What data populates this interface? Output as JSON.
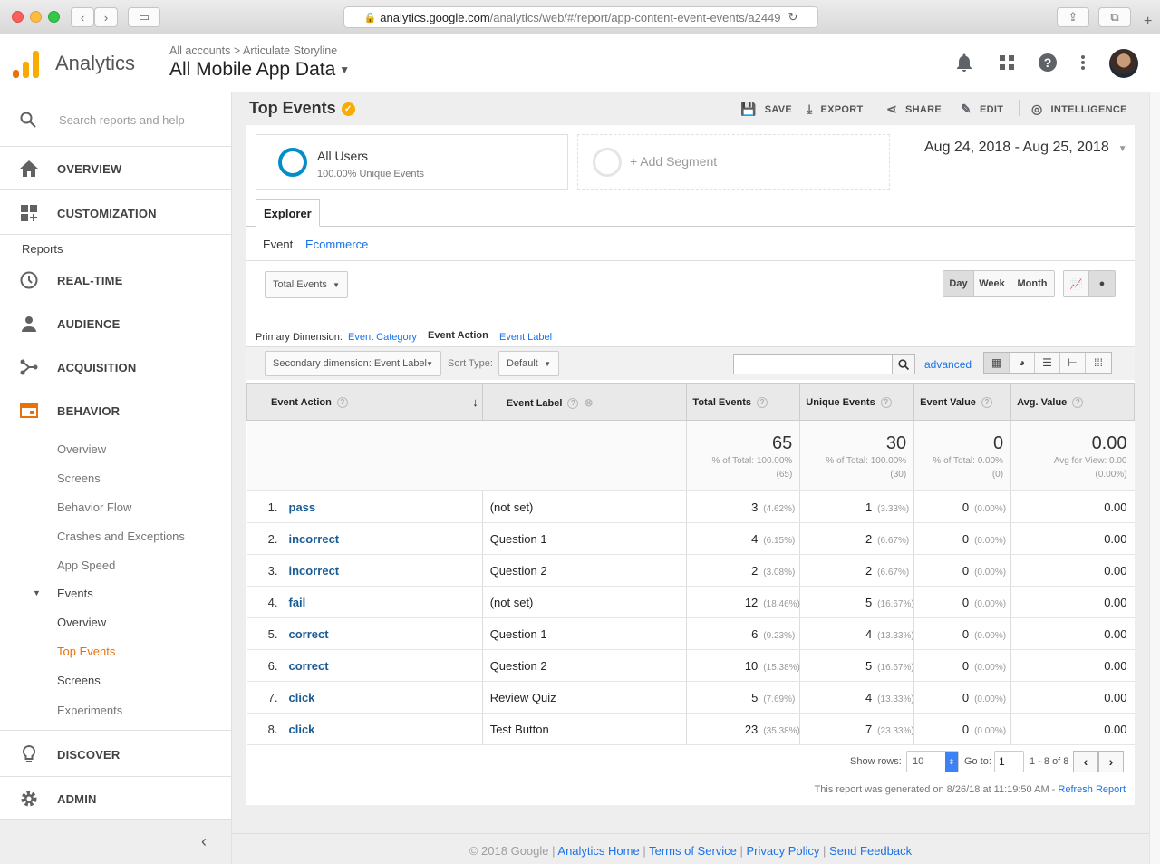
{
  "browser": {
    "url_host": "analytics.google.com",
    "url_path": "/analytics/web/#/report/app-content-event-events/a2449"
  },
  "header": {
    "brand": "Analytics",
    "crumb_root": "All accounts",
    "crumb_sep": ">",
    "crumb_account": "Articulate Storyline",
    "view_name": "All Mobile App Data",
    "icons": [
      "bell-icon",
      "apps-grid-icon",
      "help-icon",
      "more-vert-icon",
      "avatar"
    ]
  },
  "sidebar": {
    "search_placeholder": "Search reports and help",
    "overview": "OVERVIEW",
    "customization": "CUSTOMIZATION",
    "reports_heading": "Reports",
    "realtime": "REAL-TIME",
    "audience": "AUDIENCE",
    "acquisition": "ACQUISITION",
    "behavior": "BEHAVIOR",
    "behavior_sub": [
      "Overview",
      "Screens",
      "Behavior Flow",
      "Crashes and Exceptions",
      "App Speed"
    ],
    "events_label": "Events",
    "events_sub": [
      "Overview",
      "Top Events",
      "Screens"
    ],
    "experiments": "Experiments",
    "discover": "DISCOVER",
    "admin": "ADMIN",
    "accent": "#e8710a"
  },
  "report": {
    "title": "Top Events",
    "actions": {
      "save": "SAVE",
      "export": "EXPORT",
      "share": "SHARE",
      "edit": "EDIT",
      "intelligence": "INTELLIGENCE"
    },
    "segment": {
      "name": "All Users",
      "desc": "100.00% Unique Events",
      "add": "+ Add Segment"
    },
    "date_range": "Aug 24, 2018 - Aug 25, 2018",
    "tab": "Explorer",
    "subtabs": {
      "event": "Event",
      "ecommerce": "Ecommerce"
    },
    "metric_select": "Total Events",
    "granularity": {
      "day": "Day",
      "week": "Week",
      "month": "Month"
    },
    "primary_dim_label": "Primary Dimension:",
    "primary_dims": {
      "category": "Event Category",
      "action": "Event Action",
      "label": "Event Label"
    },
    "secondary_dim": "Secondary dimension: Event Label",
    "sort_type_label": "Sort Type:",
    "sort_type": "Default",
    "advanced": "advanced",
    "columns": [
      "Event Action",
      "Event Label",
      "Total Events",
      "Unique Events",
      "Event Value",
      "Avg. Value"
    ],
    "totals": {
      "total_events": "65",
      "total_events_sub1": "% of Total: 100.00%",
      "total_events_sub2": "(65)",
      "unique_events": "30",
      "unique_events_sub1": "% of Total: 100.00%",
      "unique_events_sub2": "(30)",
      "event_value": "0",
      "event_value_sub1": "% of Total: 0.00%",
      "event_value_sub2": "(0)",
      "avg_value": "0.00",
      "avg_value_sub1": "Avg for View: 0.00",
      "avg_value_sub2": "(0.00%)"
    },
    "rows": [
      {
        "n": "1.",
        "action": "pass",
        "label": "(not set)",
        "total": "3",
        "total_pct": "(4.62%)",
        "unique": "1",
        "unique_pct": "(3.33%)",
        "value": "0",
        "value_pct": "(0.00%)",
        "avg": "0.00"
      },
      {
        "n": "2.",
        "action": "incorrect",
        "label": "Question 1",
        "total": "4",
        "total_pct": "(6.15%)",
        "unique": "2",
        "unique_pct": "(6.67%)",
        "value": "0",
        "value_pct": "(0.00%)",
        "avg": "0.00"
      },
      {
        "n": "3.",
        "action": "incorrect",
        "label": "Question 2",
        "total": "2",
        "total_pct": "(3.08%)",
        "unique": "2",
        "unique_pct": "(6.67%)",
        "value": "0",
        "value_pct": "(0.00%)",
        "avg": "0.00"
      },
      {
        "n": "4.",
        "action": "fail",
        "label": "(not set)",
        "total": "12",
        "total_pct": "(18.46%)",
        "unique": "5",
        "unique_pct": "(16.67%)",
        "value": "0",
        "value_pct": "(0.00%)",
        "avg": "0.00"
      },
      {
        "n": "5.",
        "action": "correct",
        "label": "Question 1",
        "total": "6",
        "total_pct": "(9.23%)",
        "unique": "4",
        "unique_pct": "(13.33%)",
        "value": "0",
        "value_pct": "(0.00%)",
        "avg": "0.00"
      },
      {
        "n": "6.",
        "action": "correct",
        "label": "Question 2",
        "total": "10",
        "total_pct": "(15.38%)",
        "unique": "5",
        "unique_pct": "(16.67%)",
        "value": "0",
        "value_pct": "(0.00%)",
        "avg": "0.00"
      },
      {
        "n": "7.",
        "action": "click",
        "label": "Review Quiz",
        "total": "5",
        "total_pct": "(7.69%)",
        "unique": "4",
        "unique_pct": "(13.33%)",
        "value": "0",
        "value_pct": "(0.00%)",
        "avg": "0.00"
      },
      {
        "n": "8.",
        "action": "click",
        "label": "Test Button",
        "total": "23",
        "total_pct": "(35.38%)",
        "unique": "7",
        "unique_pct": "(23.33%)",
        "value": "0",
        "value_pct": "(0.00%)",
        "avg": "0.00"
      }
    ],
    "show_rows_label": "Show rows:",
    "show_rows": "10",
    "goto_label": "Go to:",
    "goto_value": "1",
    "range": "1 - 8 of 8",
    "generated": "This report was generated on 8/26/18 at 11:19:50 AM - ",
    "refresh": "Refresh Report"
  },
  "footer": {
    "copyright": "© 2018 Google",
    "links": [
      "Analytics Home",
      "Terms of Service",
      "Privacy Policy",
      "Send Feedback"
    ]
  }
}
